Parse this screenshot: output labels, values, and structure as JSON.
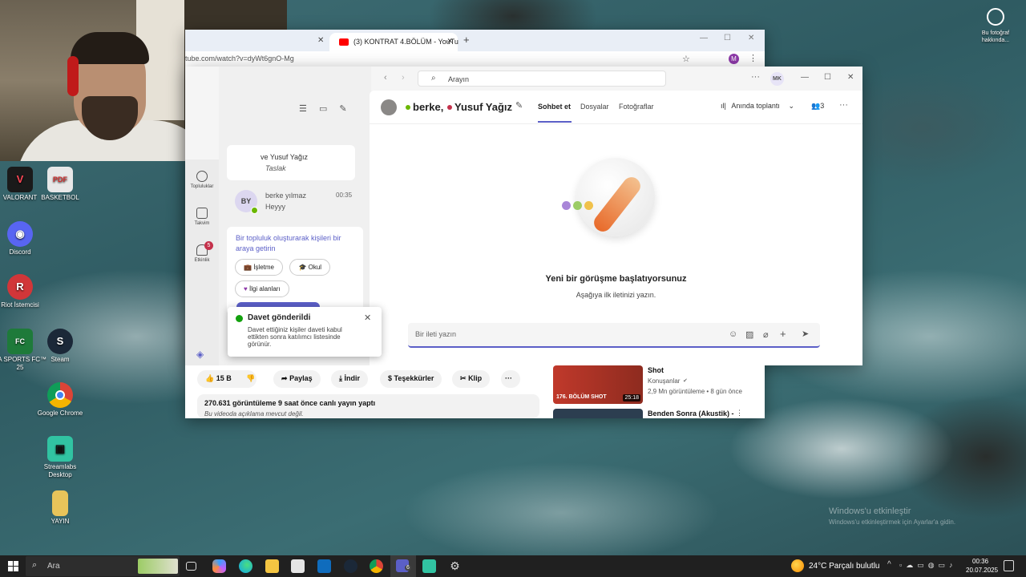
{
  "browser": {
    "tab_title": "(3) KONTRAT 4.BÖLÜM - YouTu",
    "url": "tube.com/watch?v=dyWt6gnO-Mg",
    "profile_initial": "M",
    "video_actions": {
      "like_count": "15 B",
      "share": "Paylaş",
      "download": "İndir",
      "thanks": "Teşekkürler",
      "clip": "Klip"
    },
    "views_text": "270.631 görüntüleme  9 saat önce canlı yayın yaptı",
    "description_text": "Bu videoda açıklama mevcut değil.",
    "recommendations": [
      {
        "title": "Shot",
        "channel": "Konuşanlar",
        "meta": "2,9 Mn görüntüleme • 8 gün önce",
        "duration": "25:18",
        "thumb_text": "176. BÖLÜM SHOT"
      },
      {
        "title": "Benden Sonra (Akustik) -"
      }
    ]
  },
  "teams": {
    "search_placeholder": "Arayın",
    "avatar_initials": "MK",
    "chat_title_part1": "berke,",
    "chat_title_part2": "Yusuf Yağız",
    "tabs": [
      "Sohbet et",
      "Dosyalar",
      "Fotoğraflar"
    ],
    "meet_now": "Anında toplantı",
    "participants": "3",
    "rail": [
      {
        "label": "Topluluklar"
      },
      {
        "label": "Takvim"
      },
      {
        "label": "Etkinlik",
        "badge": "5"
      }
    ],
    "chat_list": [
      {
        "name": "ve Yusuf Yağız",
        "preview": "Taslak"
      },
      {
        "initials": "BY",
        "name": "berke yılmaz",
        "time": "00:35",
        "preview": "Heyyy"
      }
    ],
    "community": {
      "title": "Bir topluluk oluşturarak kişileri bir araya getirin",
      "chips": [
        "İşletme",
        "Okul",
        "İlgi alanları"
      ]
    },
    "empty_title": "Yeni bir görüşme başlatıyorsunuz",
    "empty_sub": "Aşağıya ilk iletinizi yazın.",
    "compose_placeholder": "Bir ileti yazın",
    "toast": {
      "title": "Davet gönderildi",
      "body": "Davet ettiğiniz kişiler daveti kabul ettikten sonra katılımcı listesinde görünür."
    }
  },
  "desktop": {
    "icons": [
      {
        "label": "VALORANT"
      },
      {
        "label": "BASKETBOL"
      },
      {
        "label": "Discord"
      },
      {
        "label": "Riot İstemcisi"
      },
      {
        "label": "EA SPORTS FC™ 25"
      },
      {
        "label": "Steam"
      },
      {
        "label": "Google Chrome"
      },
      {
        "label": "Streamlabs Desktop"
      },
      {
        "label": "YAYIN"
      }
    ],
    "right_widget": "Bu fotoğraf hakkında...",
    "watermark": "Windows'u etkinleştir",
    "watermark_sub": "Windows'u etkinleştirmek için Ayarlar'a gidin."
  },
  "taskbar": {
    "search": "Ara",
    "weather": "24°C  Parçalı bulutlu",
    "time": "00:36",
    "date": "20.07.2025",
    "teams_badge": "6"
  }
}
